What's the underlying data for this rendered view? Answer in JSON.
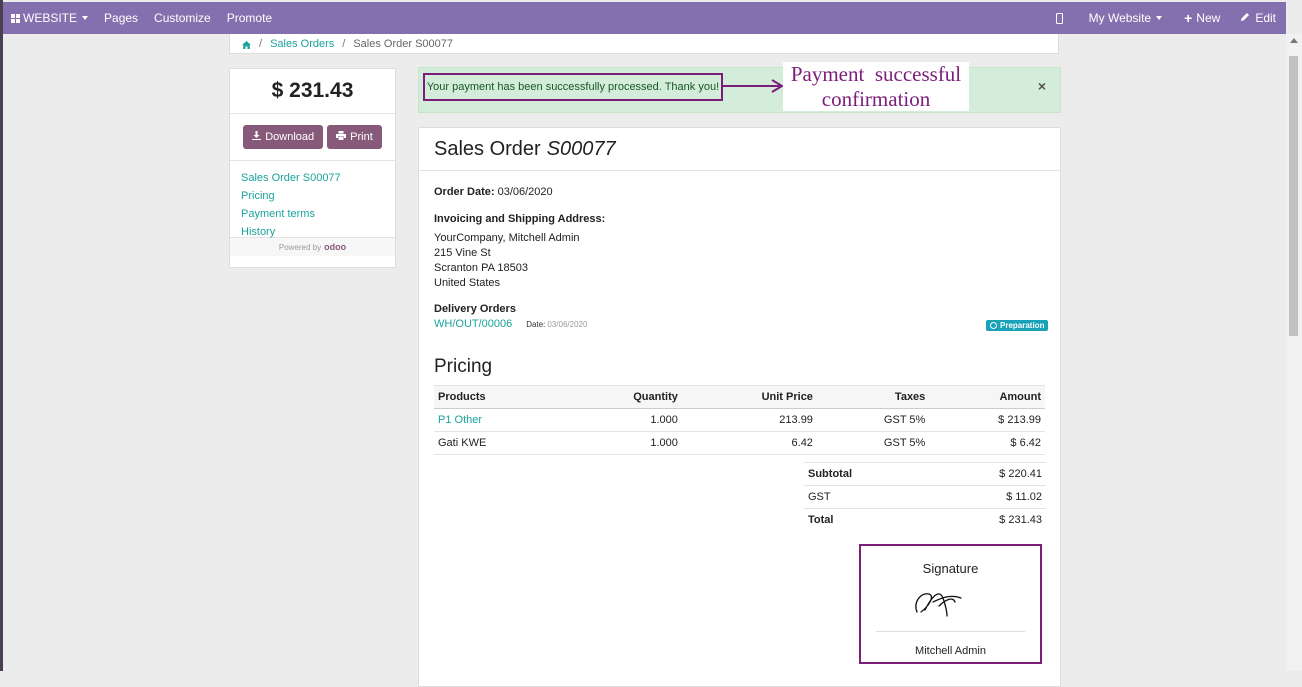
{
  "navbar": {
    "website": "WEBSITE",
    "pages": "Pages",
    "customize": "Customize",
    "promote": "Promote",
    "my_website": "My Website",
    "new": "New",
    "edit": "Edit"
  },
  "breadcrumb": {
    "sales_orders": "Sales Orders",
    "current": "Sales Order S00077"
  },
  "sidebar": {
    "total": "$ 231.43",
    "download": "Download",
    "print": "Print",
    "links": [
      "Sales Order S00077",
      "Pricing",
      "Payment terms",
      "History"
    ],
    "powered_by": "Powered by",
    "brand": "odoo"
  },
  "alert": {
    "message": "Your payment has been successfully processed. Thank you!",
    "close": "×"
  },
  "annotation": {
    "line1": "Payment  successful",
    "line2": "confirmation"
  },
  "order": {
    "title_prefix": "Sales Order",
    "number": "S00077",
    "order_date_label": "Order Date:",
    "order_date": "03/06/2020",
    "address_label": "Invoicing and Shipping Address:",
    "address": [
      "YourCompany, Mitchell Admin",
      "215 Vine St",
      "Scranton PA 18503",
      "United States"
    ],
    "delivery_label": "Delivery Orders",
    "delivery_ref": "WH/OUT/00006",
    "delivery_date_label": "Date:",
    "delivery_date": "03/06/2020",
    "status_badge": "Preparation"
  },
  "pricing": {
    "heading": "Pricing",
    "columns": [
      "Products",
      "Quantity",
      "Unit Price",
      "Taxes",
      "Amount"
    ],
    "rows": [
      {
        "product": "P1 Other",
        "qty": "1.000",
        "unit": "213.99",
        "tax": "GST 5%",
        "amount": "$ 213.99"
      },
      {
        "product": "Gati KWE",
        "qty": "1.000",
        "unit": "6.42",
        "tax": "GST 5%",
        "amount": "$ 6.42"
      }
    ],
    "subtotal_label": "Subtotal",
    "subtotal": "$ 220.41",
    "gst_label": "GST",
    "gst": "$ 11.02",
    "total_label": "Total",
    "total": "$ 231.43"
  },
  "signature": {
    "title": "Signature",
    "name": "Mitchell Admin"
  },
  "colors": {
    "navbar": "#8470ae",
    "button": "#875a7b",
    "link": "#1ba39c",
    "alert_bg": "#d4edda",
    "annotation": "#7a1e7a",
    "badge": "#17a2b8"
  }
}
